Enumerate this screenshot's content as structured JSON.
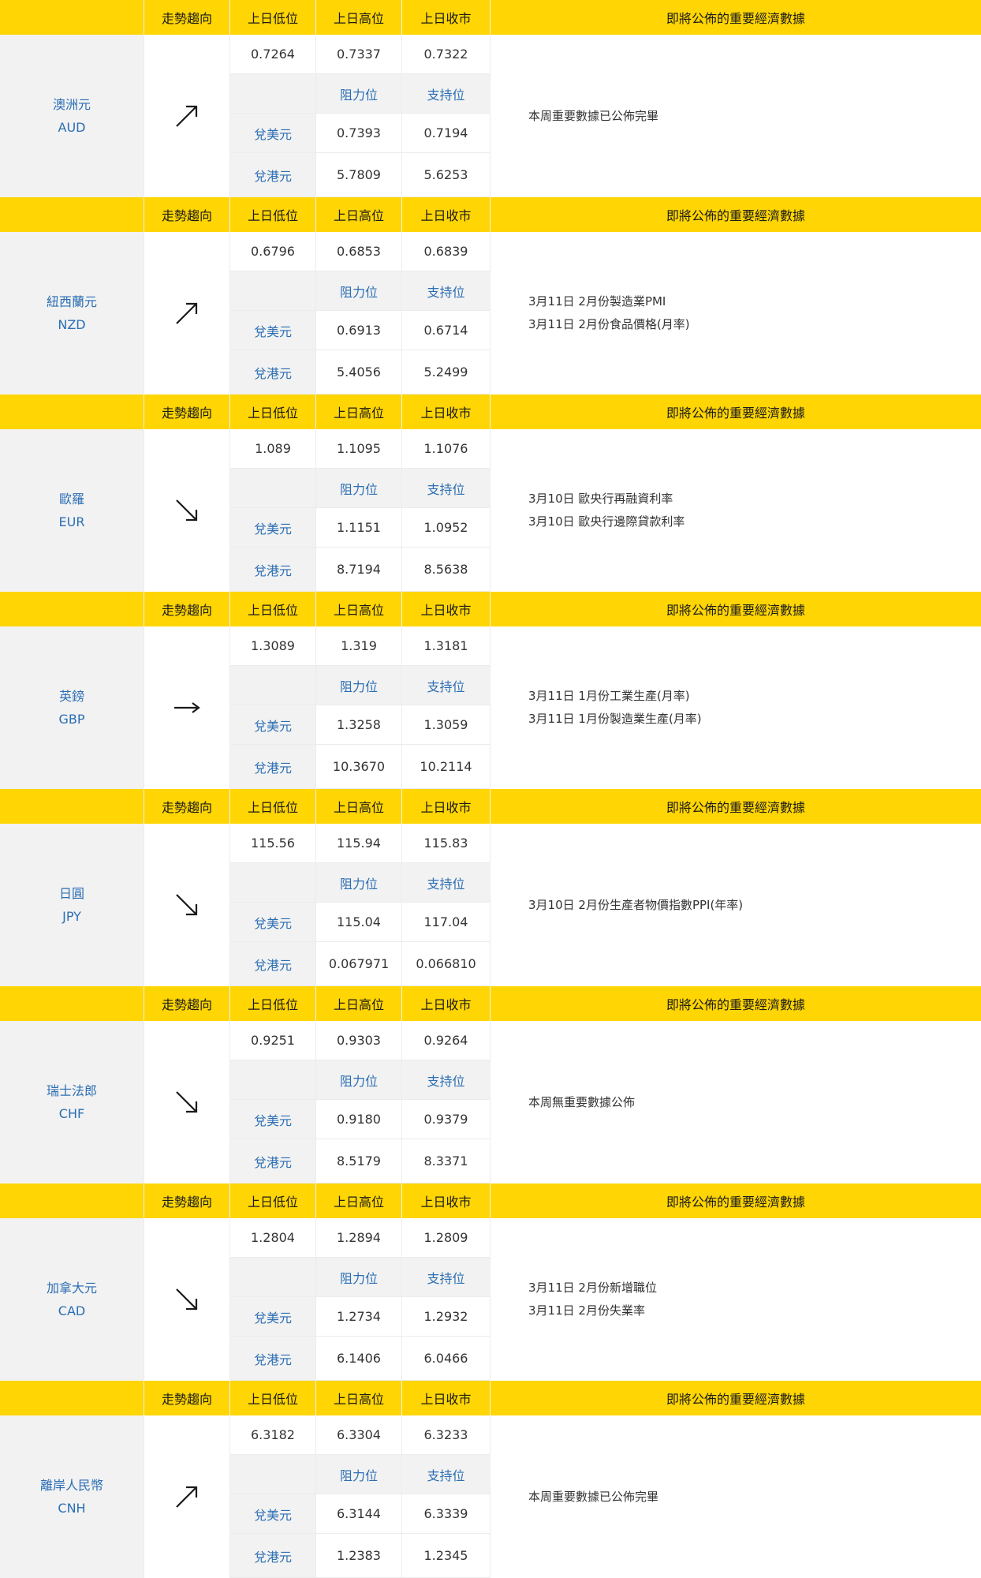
{
  "header": {
    "trend": "走勢趨向",
    "low": "上日低位",
    "high": "上日高位",
    "close": "上日收市",
    "news": "即將公佈的重要經濟數據"
  },
  "sub": {
    "resistance": "阻力位",
    "support": "支持位",
    "vs_usd": "兌美元",
    "vs_hkd": "兌港元"
  },
  "icons": {
    "up": "arrow-up-right-icon",
    "down": "arrow-down-right-icon",
    "flat": "arrow-right-icon"
  },
  "colors": {
    "header_bg": "#ffd503",
    "label_blue": "#2b6eb4",
    "row_gray": "#f2f2f2"
  },
  "currencies": [
    {
      "name": "澳洲元",
      "code": "AUD",
      "trend": "up",
      "low": "0.7264",
      "high": "0.7337",
      "close": "0.7322",
      "usd_res": "0.7393",
      "usd_sup": "0.7194",
      "hkd_res": "5.7809",
      "hkd_sup": "5.6253",
      "news": [
        "本周重要數據已公佈完畢"
      ]
    },
    {
      "name": "紐西蘭元",
      "code": "NZD",
      "trend": "up",
      "low": "0.6796",
      "high": "0.6853",
      "close": "0.6839",
      "usd_res": "0.6913",
      "usd_sup": "0.6714",
      "hkd_res": "5.4056",
      "hkd_sup": "5.2499",
      "news": [
        "3月11日 2月份製造業PMI",
        "3月11日 2月份食品價格(月率)"
      ]
    },
    {
      "name": "歐羅",
      "code": "EUR",
      "trend": "down",
      "low": "1.089",
      "high": "1.1095",
      "close": "1.1076",
      "usd_res": "1.1151",
      "usd_sup": "1.0952",
      "hkd_res": "8.7194",
      "hkd_sup": "8.5638",
      "news": [
        "3月10日 歐央行再融資利率",
        "3月10日 歐央行邊際貸款利率"
      ]
    },
    {
      "name": "英鎊",
      "code": "GBP",
      "trend": "flat",
      "low": "1.3089",
      "high": "1.319",
      "close": "1.3181",
      "usd_res": "1.3258",
      "usd_sup": "1.3059",
      "hkd_res": "10.3670",
      "hkd_sup": "10.2114",
      "news": [
        "3月11日 1月份工業生產(月率)",
        "3月11日 1月份製造業生產(月率)"
      ]
    },
    {
      "name": "日圓",
      "code": "JPY",
      "trend": "down",
      "low": "115.56",
      "high": "115.94",
      "close": "115.83",
      "usd_res": "115.04",
      "usd_sup": "117.04",
      "hkd_res": "0.067971",
      "hkd_sup": "0.066810",
      "news": [
        "3月10日 2月份生產者物價指數PPI(年率)"
      ]
    },
    {
      "name": "瑞士法郎",
      "code": "CHF",
      "trend": "down",
      "low": "0.9251",
      "high": "0.9303",
      "close": "0.9264",
      "usd_res": "0.9180",
      "usd_sup": "0.9379",
      "hkd_res": "8.5179",
      "hkd_sup": "8.3371",
      "news": [
        "本周無重要數據公佈"
      ]
    },
    {
      "name": "加拿大元",
      "code": "CAD",
      "trend": "down",
      "low": "1.2804",
      "high": "1.2894",
      "close": "1.2809",
      "usd_res": "1.2734",
      "usd_sup": "1.2932",
      "hkd_res": "6.1406",
      "hkd_sup": "6.0466",
      "news": [
        "3月11日 2月份新增職位",
        "3月11日 2月份失業率"
      ]
    },
    {
      "name": "離岸人民幣",
      "code": "CNH",
      "trend": "up",
      "low": "6.3182",
      "high": "6.3304",
      "close": "6.3233",
      "usd_res": "6.3144",
      "usd_sup": "6.3339",
      "hkd_res": "1.2383",
      "hkd_sup": "1.2345",
      "news": [
        "本周重要數據已公佈完畢"
      ]
    }
  ]
}
